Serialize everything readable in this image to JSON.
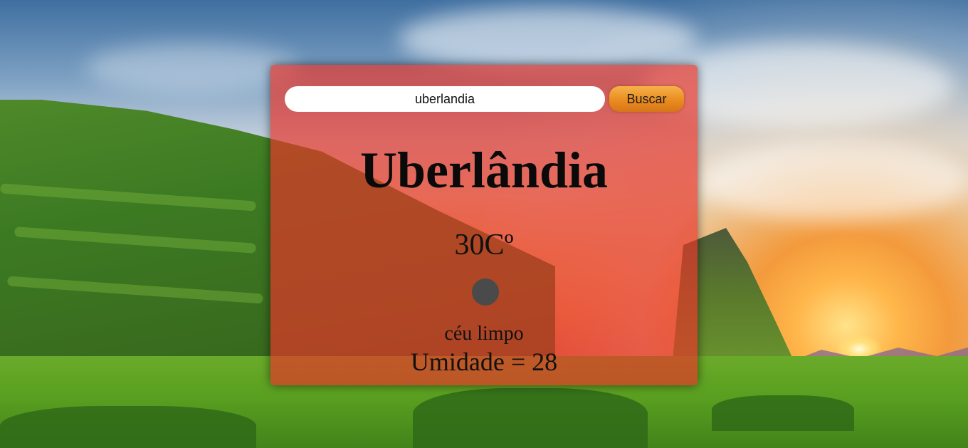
{
  "search": {
    "value": "uberlandia",
    "button_label": "Buscar"
  },
  "weather": {
    "city": "Uberlândia",
    "temperature": "30Cº",
    "icon": "weather-condition-icon",
    "description": "céu limpo",
    "humidity_text": "Umidade = 28"
  },
  "colors": {
    "card_background": "#e83428",
    "button_accent": "#e8891c",
    "icon_fill": "#4a4a4a"
  }
}
